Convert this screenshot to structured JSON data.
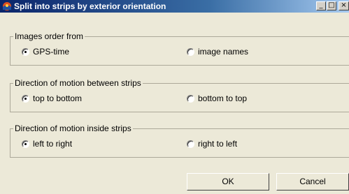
{
  "window": {
    "title": "Split into strips by exterior orientation",
    "controls": {
      "minimize": "_",
      "maximize": "□",
      "close": "×"
    }
  },
  "groups": [
    {
      "label": "Images order from",
      "options": [
        "GPS-time",
        "image names"
      ],
      "selected": 0
    },
    {
      "label": "Direction of motion between strips",
      "options": [
        "top to bottom",
        "bottom to top"
      ],
      "selected": 0
    },
    {
      "label": "Direction of motion inside strips",
      "options": [
        "left to right",
        "right to left"
      ],
      "selected": 0
    }
  ],
  "buttons": {
    "ok": "OK",
    "cancel": "Cancel"
  },
  "icons": {
    "app": "app-logo-icon"
  }
}
